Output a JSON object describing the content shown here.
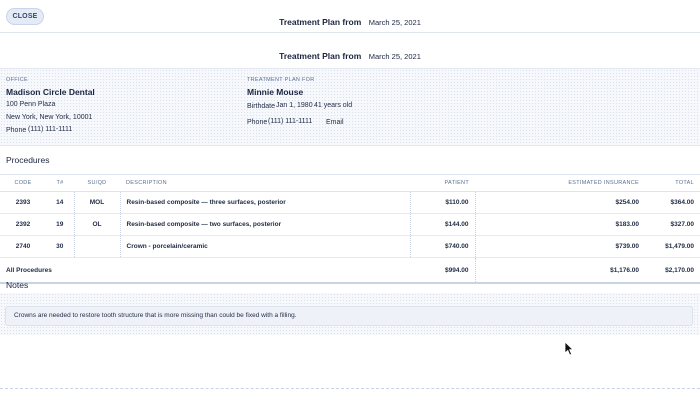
{
  "header": {
    "close_label": "CLOSE",
    "title": "Treatment Plan from",
    "date": "March 25, 2021"
  },
  "document": {
    "title": "Treatment Plan from",
    "date": "March 25, 2021"
  },
  "office": {
    "label": "OFFICE",
    "name": "Madison Circle Dental",
    "address1": "100 Penn Plaza",
    "address2": "New York, New York, 10001",
    "phone_label": "Phone",
    "phone": "(111) 111-1111"
  },
  "patient": {
    "label": "TREATMENT PLAN FOR",
    "name": "Minnie Mouse",
    "birthdate_label": "Birthdate",
    "birthdate": "Jan 1, 1980",
    "age": "41 years old",
    "phone_label": "Phone",
    "phone": "(111) 111-1111",
    "email_label": "Email"
  },
  "procedures": {
    "heading": "Procedures",
    "columns": {
      "code": "CODE",
      "tooth": "T#",
      "surface": "SU/QD",
      "description": "DESCRIPTION",
      "patient": "PATIENT",
      "insurance": "ESTIMATED INSURANCE",
      "total": "TOTAL"
    },
    "rows": [
      {
        "code": "2393",
        "tooth": "14",
        "surface": "MOL",
        "description": "Resin-based composite — three surfaces, posterior",
        "patient": "$110.00",
        "insurance": "$254.00",
        "total": "$364.00"
      },
      {
        "code": "2392",
        "tooth": "19",
        "surface": "OL",
        "description": "Resin-based composite — two surfaces, posterior",
        "patient": "$144.00",
        "insurance": "$183.00",
        "total": "$327.00"
      },
      {
        "code": "2740",
        "tooth": "30",
        "surface": "",
        "description": "Crown - porcelain/ceramic",
        "patient": "$740.00",
        "insurance": "$739.00",
        "total": "$1,479.00"
      }
    ],
    "totals": {
      "label": "All Procedures",
      "patient": "$994.00",
      "insurance": "$1,176.00",
      "total": "$2,170.00"
    }
  },
  "notes": {
    "heading": "Notes",
    "text": "Crowns are needed to restore tooth structure that is more missing than could be fixed with a filling."
  },
  "icons": {
    "cursor": "mouse-pointer-icon"
  },
  "colors": {
    "accent_bg": "#e4ebf6",
    "text_dark": "#1c2540",
    "label_blue": "#5a6f92"
  }
}
